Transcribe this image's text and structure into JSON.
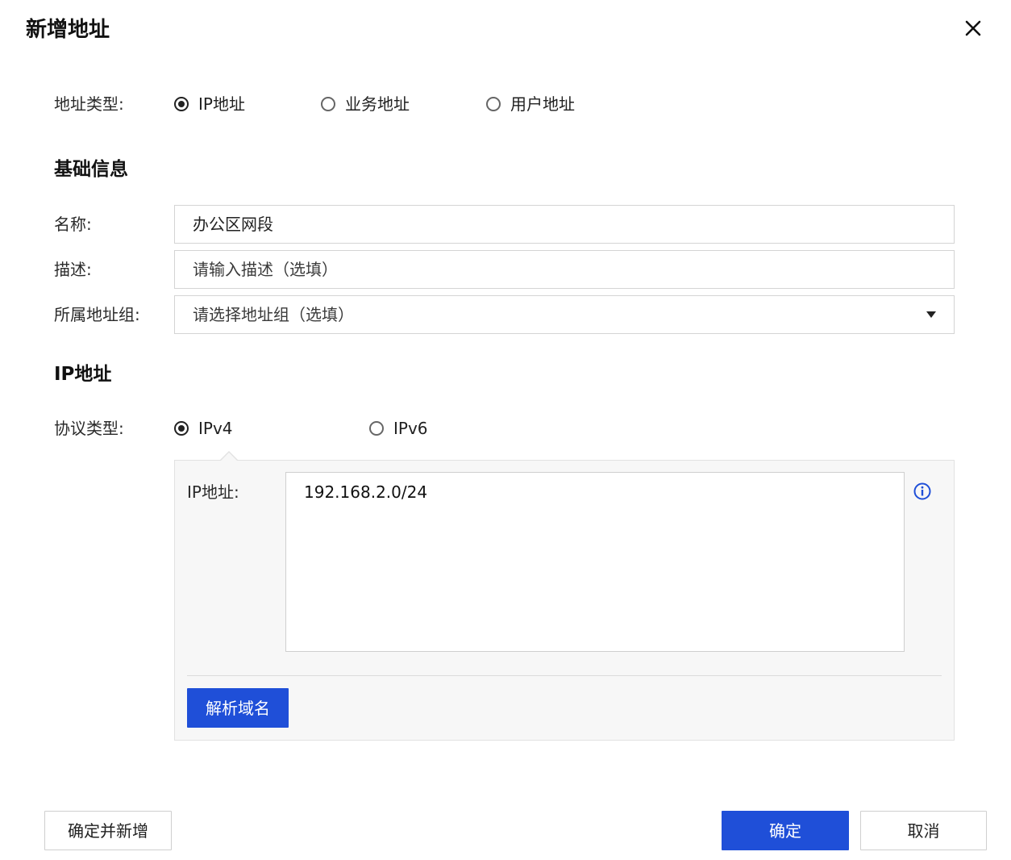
{
  "dialog": {
    "title": "新增地址",
    "close_icon": "close-icon"
  },
  "address_type": {
    "label": "地址类型:",
    "options": [
      {
        "label": "IP地址",
        "selected": true
      },
      {
        "label": "业务地址",
        "selected": false
      },
      {
        "label": "用户地址",
        "selected": false
      }
    ]
  },
  "basic_info": {
    "heading": "基础信息",
    "name": {
      "label": "名称:",
      "value": "办公区网段"
    },
    "description": {
      "label": "描述:",
      "placeholder": "请输入描述（选填）"
    },
    "group": {
      "label": "所属地址组:",
      "placeholder": "请选择地址组（选填）"
    }
  },
  "ip_section": {
    "heading": "IP地址",
    "protocol": {
      "label": "协议类型:",
      "options": [
        {
          "label": "IPv4",
          "selected": true
        },
        {
          "label": "IPv6",
          "selected": false
        }
      ]
    },
    "ip_field": {
      "label": "IP地址:",
      "value": "192.168.2.0/24"
    },
    "resolve_button": "解析域名"
  },
  "footer": {
    "confirm_and_add": "确定并新增",
    "confirm": "确定",
    "cancel": "取消"
  },
  "colors": {
    "primary": "#1f4fd8",
    "info": "#1f4fd8"
  }
}
